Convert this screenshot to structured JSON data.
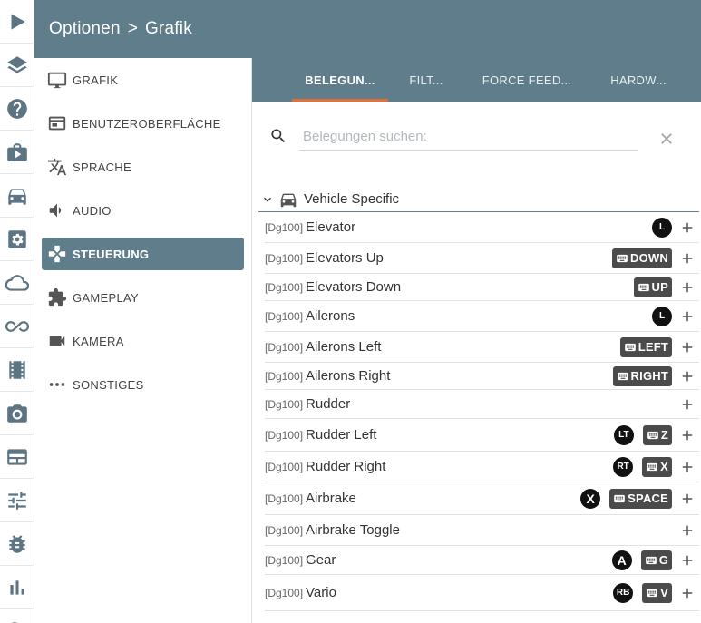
{
  "header": {
    "breadcrumb": [
      "Optionen",
      "Grafik"
    ],
    "separator": ">"
  },
  "rail": [
    "play-icon",
    "layers-icon",
    "help-icon",
    "briefcase-icon",
    "car-icon",
    "settings-icon",
    "cloud-icon",
    "infinity-icon",
    "film-icon",
    "camera-icon",
    "panel-icon",
    "sliders-icon",
    "bug-icon",
    "chart-icon",
    "search-icon"
  ],
  "menu": {
    "items": [
      {
        "label": "GRAFIK",
        "icon": "monitor-icon"
      },
      {
        "label": "BENUTZEROBERFLÄCHE",
        "icon": "window-icon"
      },
      {
        "label": "SPRACHE",
        "icon": "translate-icon"
      },
      {
        "label": "AUDIO",
        "icon": "volume-icon"
      },
      {
        "label": "STEUERUNG",
        "icon": "gamepad-icon",
        "active": true
      },
      {
        "label": "GAMEPLAY",
        "icon": "puzzle-icon"
      },
      {
        "label": "KAMERA",
        "icon": "video-icon"
      },
      {
        "label": "SONSTIGES",
        "icon": "more-icon"
      }
    ]
  },
  "tabs": [
    {
      "label": "BELEGUN...",
      "active": true
    },
    {
      "label": "FILT..."
    },
    {
      "label": "FORCE FEED..."
    },
    {
      "label": "HARDW..."
    }
  ],
  "search": {
    "placeholder": "Belegungen suchen:",
    "value": ""
  },
  "section": {
    "title": "Vehicle Specific",
    "icon": "car-icon"
  },
  "rows": [
    {
      "prefix": "[Dg100]",
      "name": "Elevator",
      "bindings": [
        {
          "type": "pad",
          "label": "L",
          "icon": "left-stick-vertical-icon"
        }
      ]
    },
    {
      "prefix": "[Dg100]",
      "name": "Elevators Up",
      "bindings": [
        {
          "type": "key",
          "label": "DOWN"
        }
      ]
    },
    {
      "prefix": "[Dg100]",
      "name": "Elevators Down",
      "bindings": [
        {
          "type": "key",
          "label": "UP"
        }
      ]
    },
    {
      "prefix": "[Dg100]",
      "name": "Ailerons",
      "bindings": [
        {
          "type": "pad",
          "label": "L",
          "icon": "left-stick-horizontal-icon"
        }
      ]
    },
    {
      "prefix": "[Dg100]",
      "name": "Ailerons Left",
      "bindings": [
        {
          "type": "key",
          "label": "LEFT"
        }
      ]
    },
    {
      "prefix": "[Dg100]",
      "name": "Ailerons Right",
      "bindings": [
        {
          "type": "key",
          "label": "RIGHT"
        }
      ]
    },
    {
      "prefix": "[Dg100]",
      "name": "Rudder",
      "bindings": []
    },
    {
      "prefix": "[Dg100]",
      "name": "Rudder Left",
      "bindings": [
        {
          "type": "pad",
          "label": "LT"
        },
        {
          "type": "key",
          "label": "Z"
        }
      ]
    },
    {
      "prefix": "[Dg100]",
      "name": "Rudder Right",
      "bindings": [
        {
          "type": "pad",
          "label": "RT"
        },
        {
          "type": "key",
          "label": "X"
        }
      ]
    },
    {
      "prefix": "[Dg100]",
      "name": "Airbrake",
      "bindings": [
        {
          "type": "pad",
          "label": "X"
        },
        {
          "type": "key",
          "label": "SPACE"
        }
      ]
    },
    {
      "prefix": "[Dg100]",
      "name": "Airbrake Toggle",
      "bindings": []
    },
    {
      "prefix": "[Dg100]",
      "name": "Gear",
      "bindings": [
        {
          "type": "pad",
          "label": "A"
        },
        {
          "type": "key",
          "label": "G"
        }
      ]
    },
    {
      "prefix": "[Dg100]",
      "name": "Vario",
      "bindings": [
        {
          "type": "pad",
          "label": "RB"
        },
        {
          "type": "key",
          "label": "V"
        }
      ]
    }
  ],
  "colors": {
    "header": "#607d8b",
    "accent": "#e0703a",
    "active_item": "#607d8b",
    "rail_icon": "#5d7583"
  }
}
